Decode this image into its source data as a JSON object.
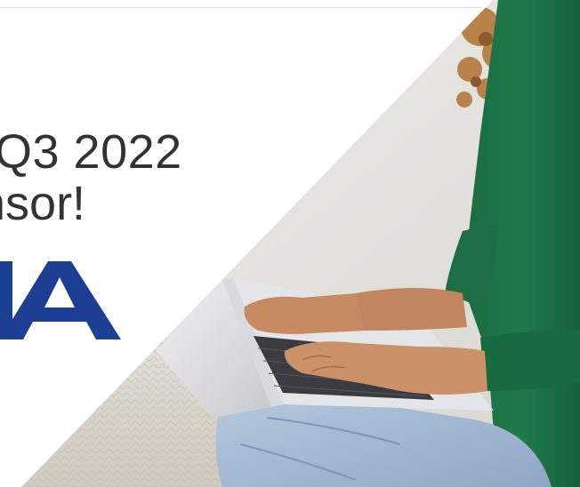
{
  "slide": {
    "headline": {
      "line1": "Q3 2022",
      "line2": "nsor!"
    },
    "logo": {
      "visible_letters": "IA",
      "color": "#1d3f93"
    },
    "photo": {
      "subject": "person-typing-on-laptop-icon",
      "sweater_color": "#1f7a4a",
      "jeans_color": "#a9bfd8"
    },
    "colors": {
      "background": "#ffffff",
      "text": "#333333",
      "brand_blue": "#1d3f93"
    }
  }
}
